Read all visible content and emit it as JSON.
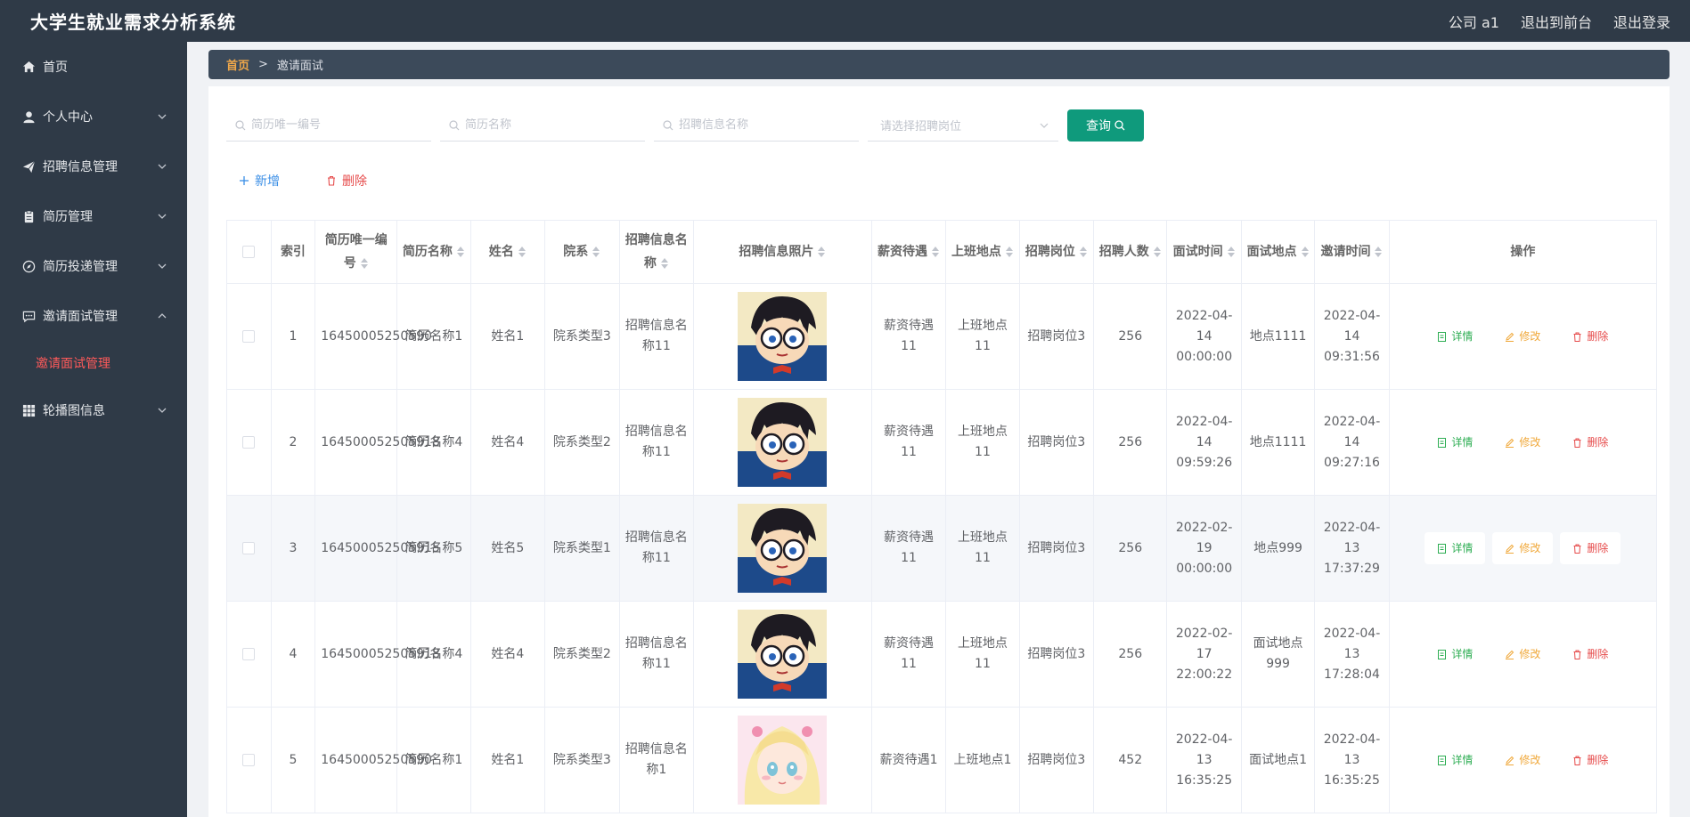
{
  "header": {
    "title": "大学生就业需求分析系统",
    "user": "公司 a1",
    "front_link": "退出到前台",
    "logout": "退出登录"
  },
  "sidebar": {
    "items": [
      {
        "label": "首页",
        "icon": "home-icon"
      },
      {
        "label": "个人中心",
        "icon": "user-icon"
      },
      {
        "label": "招聘信息管理",
        "icon": "send-icon"
      },
      {
        "label": "简历管理",
        "icon": "document-icon"
      },
      {
        "label": "简历投递管理",
        "icon": "compass-icon"
      },
      {
        "label": "邀请面试管理",
        "icon": "chat-icon"
      },
      {
        "label": "轮播图信息",
        "icon": "grid-icon"
      }
    ],
    "subitem": "邀请面试管理"
  },
  "breadcrumb": {
    "home": "首页",
    "sep": ">",
    "current": "邀请面试"
  },
  "search": {
    "resume_no_placeholder": "简历唯一编号",
    "resume_name_placeholder": "简历名称",
    "job_info_placeholder": "招聘信息名称",
    "position_placeholder": "请选择招聘岗位",
    "query_label": "查询"
  },
  "actions": {
    "add": "新增",
    "delete": "删除"
  },
  "table": {
    "headers": [
      "索引",
      "简历唯一编号",
      "简历名称",
      "姓名",
      "院系",
      "招聘信息名称",
      "招聘信息照片",
      "薪资待遇",
      "上班地点",
      "招聘岗位",
      "招聘人数",
      "面试时间",
      "面试地点",
      "邀请时间",
      "操作"
    ],
    "rows": [
      {
        "idx": "1",
        "no": "16450005250590",
        "resume": "简历名称1",
        "name": "姓名1",
        "dept": "院系类型3",
        "info": "招聘信息名称11",
        "photo": "conan",
        "salary": "薪资待遇11",
        "place": "上班地点11",
        "post": "招聘岗位3",
        "count": "256",
        "itime": "2022-04-14 00:00:00",
        "iplace": "地点1111",
        "vtime": "2022-04-14 09:31:56"
      },
      {
        "idx": "2",
        "no": "164500052505918",
        "resume": "简历名称4",
        "name": "姓名4",
        "dept": "院系类型2",
        "info": "招聘信息名称11",
        "photo": "conan",
        "salary": "薪资待遇11",
        "place": "上班地点11",
        "post": "招聘岗位3",
        "count": "256",
        "itime": "2022-04-14 09:59:26",
        "iplace": "地点1111",
        "vtime": "2022-04-14 09:27:16"
      },
      {
        "idx": "3",
        "no": "164500052505915",
        "resume": "简历名称5",
        "name": "姓名5",
        "dept": "院系类型1",
        "info": "招聘信息名称11",
        "photo": "conan",
        "salary": "薪资待遇11",
        "place": "上班地点11",
        "post": "招聘岗位3",
        "count": "256",
        "itime": "2022-02-19 00:00:00",
        "iplace": "地点999",
        "vtime": "2022-04-13 17:37:29"
      },
      {
        "idx": "4",
        "no": "164500052505918",
        "resume": "简历名称4",
        "name": "姓名4",
        "dept": "院系类型2",
        "info": "招聘信息名称11",
        "photo": "conan",
        "salary": "薪资待遇11",
        "place": "上班地点11",
        "post": "招聘岗位3",
        "count": "256",
        "itime": "2022-02-17 22:00:22",
        "iplace": "面试地点999",
        "vtime": "2022-04-13 17:28:04"
      },
      {
        "idx": "5",
        "no": "16450005250590",
        "resume": "简历名称1",
        "name": "姓名1",
        "dept": "院系类型3",
        "info": "招聘信息名称1",
        "photo": "anime-girl",
        "salary": "薪资待遇1",
        "place": "上班地点1",
        "post": "招聘岗位3",
        "count": "452",
        "itime": "2022-04-13 16:35:25",
        "iplace": "面试地点1",
        "vtime": "2022-04-13 16:35:25"
      }
    ],
    "ops": {
      "detail": "详情",
      "edit": "修改",
      "delete": "删除"
    }
  },
  "colors": {
    "header_bg": "#2f3a47",
    "accent": "#0f9a7c",
    "active_submenu": "#ff5a5a",
    "breadcrumb_home": "#f0a84a"
  }
}
